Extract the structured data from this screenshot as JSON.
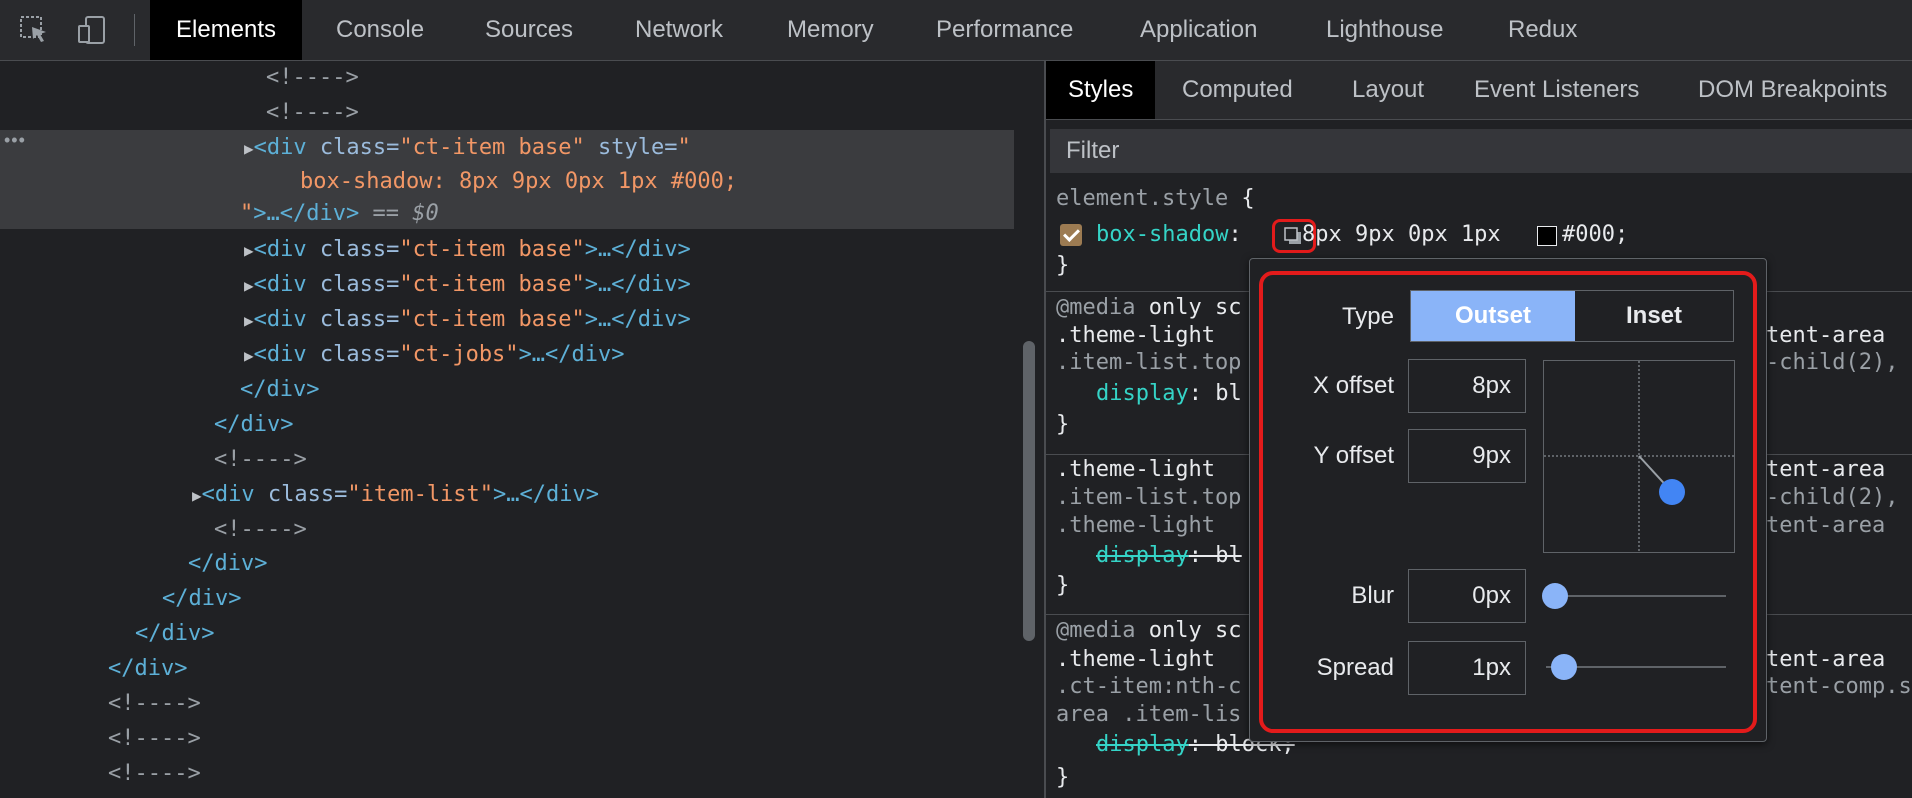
{
  "toolbar": {
    "tabs": [
      "Elements",
      "Console",
      "Sources",
      "Network",
      "Memory",
      "Performance",
      "Application",
      "Lighthouse",
      "Redux"
    ],
    "active_tab": "Elements"
  },
  "elements": {
    "lines": [
      {
        "text": "<!---->"
      },
      {
        "text": "<!---->"
      },
      {
        "tag_open": "<div",
        "attr1": " class=",
        "val1": "\"ct-item base\"",
        "attr2": " style=",
        "val2": "\""
      },
      {
        "val": "box-shadow: 8px 9px 0px 1px #000;"
      },
      {
        "val_end": "\"",
        "tag": ">…</div>",
        "eq": " == ",
        "dollar": "$0"
      },
      {
        "tag_open": "<div",
        "attr": " class=",
        "val": "\"ct-item base\"",
        "tag_close": ">…</div>"
      },
      {
        "tag_open": "<div",
        "attr": " class=",
        "val": "\"ct-item base\"",
        "tag_close": ">…</div>"
      },
      {
        "tag_open": "<div",
        "attr": " class=",
        "val": "\"ct-item base\"",
        "tag_close": ">…</div>"
      },
      {
        "tag_open": "<div",
        "attr": " class=",
        "val": "\"ct-jobs\"",
        "tag_close": ">…</div>"
      },
      {
        "text": "</div>"
      },
      {
        "text": "</div>"
      },
      {
        "text": "<!---->"
      },
      {
        "tag_open": "<div",
        "attr": " class=",
        "val": "\"item-list\"",
        "tag_close": ">…</div>"
      },
      {
        "text": "<!---->"
      },
      {
        "text": "</div>"
      },
      {
        "text": "</div>"
      },
      {
        "text": "</div>"
      },
      {
        "text": "</div>"
      },
      {
        "text": "<!---->"
      },
      {
        "text": "<!---->"
      },
      {
        "text": "<!---->"
      }
    ]
  },
  "styles": {
    "tabs": [
      "Styles",
      "Computed",
      "Layout",
      "Event Listeners",
      "DOM Breakpoints"
    ],
    "active_tab": "Styles",
    "filter_placeholder": "Filter",
    "element_style": {
      "selector": "element.style",
      "open_brace": " {",
      "property": "box-shadow",
      "colon": ":",
      "value": "8px 9px 0px 1px",
      "color_value": "#000;",
      "close_brace": "}"
    },
    "rules": [
      {
        "media": "@media",
        "media_rest": " only sc",
        "sel1": ".theme-light ",
        "sel1_right": "tent-area",
        "sel2": ".item-list.top",
        "sel2_right": "-child(2),",
        "prop": "display",
        "val": ": bl",
        "close": "}"
      },
      {
        "sel1": ".theme-light ",
        "sel1_right": "tent-area",
        "sel2": ".item-list.top",
        "sel2_right": "-child(2),",
        "sel3": ".theme-light ",
        "sel3_right": "tent-area",
        "prop": "display",
        "val": ": bl",
        "close": "}"
      },
      {
        "media": "@media",
        "media_rest": " only sc",
        "sel1": ".theme-light ",
        "sel1_right": "tent-area",
        "sel2": ".ct-item:nth-c",
        "sel2_right": "tent-comp.s",
        "sel3": "area .item-lis",
        "prop": "display",
        "val": ": block;",
        "close": "}"
      }
    ]
  },
  "shadow_editor": {
    "type_label": "Type",
    "outset_label": "Outset",
    "inset_label": "Inset",
    "x_label": "X offset",
    "x_value": "8px",
    "y_label": "Y offset",
    "y_value": "9px",
    "blur_label": "Blur",
    "blur_value": "0px",
    "spread_label": "Spread",
    "spread_value": "1px",
    "selected_type": "Outset"
  },
  "colors": {
    "accent": "#8ab4f8",
    "highlight_outline": "#e31b1b"
  }
}
